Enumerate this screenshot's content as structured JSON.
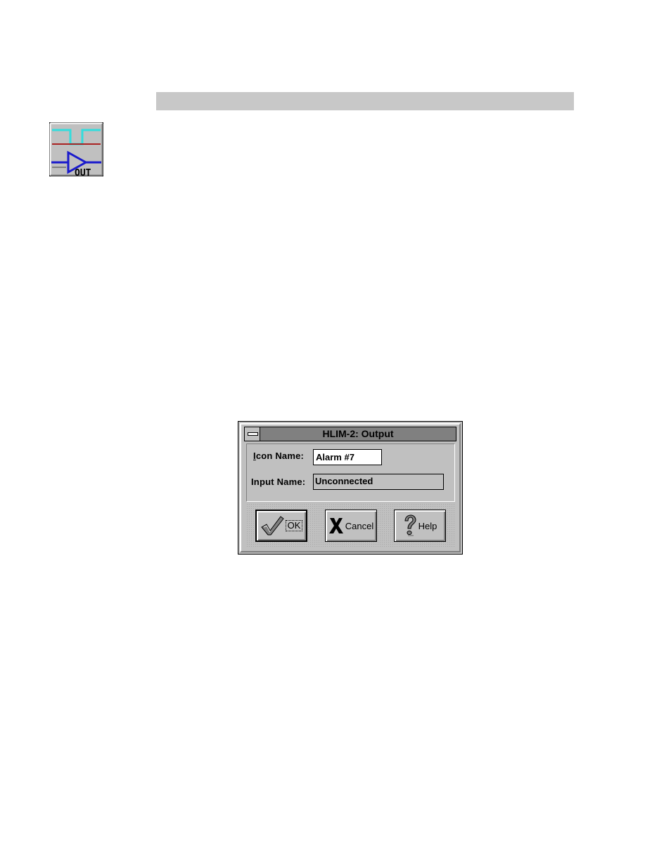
{
  "dialog": {
    "title": "HLIM-2: Output",
    "icon_name_label_accel": "I",
    "icon_name_label_rest": "con Name:",
    "icon_name_value": "Alarm #7",
    "input_name_label": "Input Name:",
    "input_name_value": "Unconnected",
    "buttons": {
      "ok_label": "OK",
      "cancel_label": "Cancel",
      "help_label": "Help"
    }
  },
  "block_icon": {
    "text": "OUT",
    "colors": {
      "waveform": "#33dddd",
      "threshold": "#aa2222",
      "amplifier": "#1a1acc",
      "background": "#c0c0c0"
    }
  },
  "header_bar": {
    "color": "#c8c8c8"
  }
}
